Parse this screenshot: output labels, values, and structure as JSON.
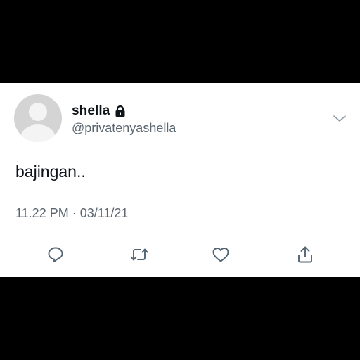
{
  "tweet": {
    "display_name": "shella",
    "handle": "@privatenyashella",
    "text": "bajingan..",
    "timestamp": "11.22 PM · 03/11/21",
    "protected_icon": "lock-icon",
    "menu_icon": "chevron-down-icon"
  },
  "actions": [
    {
      "name": "reply",
      "icon": "reply-icon"
    },
    {
      "name": "retweet",
      "icon": "retweet-icon"
    },
    {
      "name": "like",
      "icon": "heart-icon"
    },
    {
      "name": "share",
      "icon": "share-icon"
    }
  ],
  "colors": {
    "text": "#0f1419",
    "secondary": "#5b6670",
    "background": "#ffffff",
    "letterbox": "#000000",
    "avatar_placeholder": "#d4d4d4"
  }
}
